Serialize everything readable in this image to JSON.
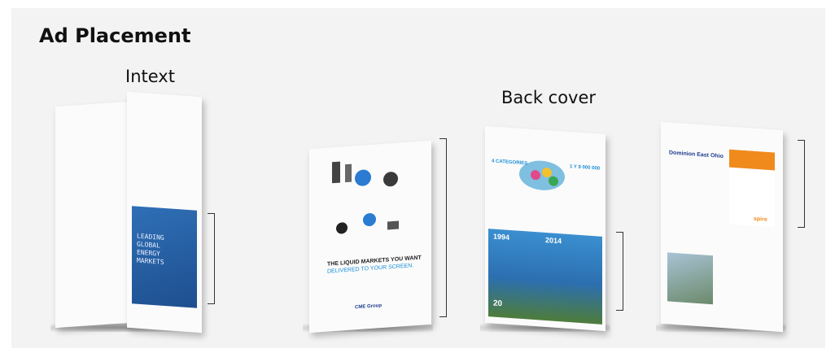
{
  "heading": "Ad Placement",
  "captions": {
    "intext": "Intext",
    "back_cover": "Back cover"
  },
  "intext_ad": {
    "lines": [
      "LEADING",
      "GLOBAL",
      "ENERGY",
      "MARKETS"
    ]
  },
  "cme_ad": {
    "headline": "THE LIQUID MARKETS YOU WANT",
    "subhead": "DELIVERED TO YOUR SCREEN.",
    "brand": "CME Group"
  },
  "gas_ad": {
    "left_label": "4 CATEGORIES",
    "right_label": "1 Y 9 000 000",
    "year1": "1994",
    "year2": "2014",
    "age": "20"
  },
  "dominion_ad": {
    "title": "Dominion East Ohio",
    "brand": "spire"
  }
}
